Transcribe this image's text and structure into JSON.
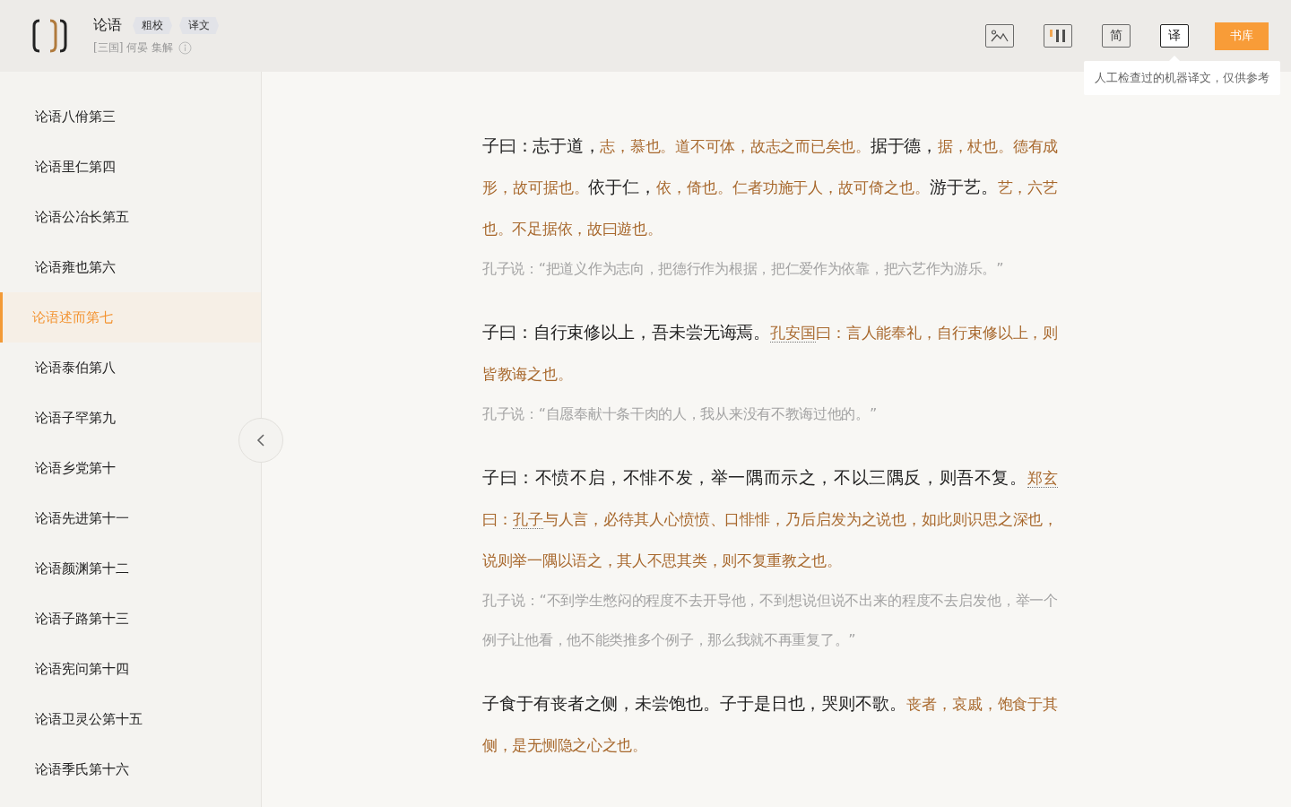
{
  "header": {
    "title": "论语",
    "tags": [
      "粗校",
      "译文"
    ],
    "subtitle": "[三国] 何晏 集解",
    "tools": [
      {
        "kind": "picture",
        "active": false
      },
      {
        "kind": "columns",
        "active": false
      },
      {
        "kind": "text",
        "label": "简",
        "active": false
      },
      {
        "kind": "text",
        "label": "译",
        "active": true
      }
    ],
    "library_button": "书库",
    "tooltip": "人工检查过的机器译文，仅供参考"
  },
  "sidebar": {
    "items": [
      {
        "label": "论语八佾第三",
        "selected": false
      },
      {
        "label": "论语里仁第四",
        "selected": false
      },
      {
        "label": "论语公冶长第五",
        "selected": false
      },
      {
        "label": "论语雍也第六",
        "selected": false
      },
      {
        "label": "论语述而第七",
        "selected": true
      },
      {
        "label": "论语泰伯第八",
        "selected": false
      },
      {
        "label": "论语子罕第九",
        "selected": false
      },
      {
        "label": "论语乡党第十",
        "selected": false
      },
      {
        "label": "论语先进第十一",
        "selected": false
      },
      {
        "label": "论语颜渊第十二",
        "selected": false
      },
      {
        "label": "论语子路第十三",
        "selected": false
      },
      {
        "label": "论语宪问第十四",
        "selected": false
      },
      {
        "label": "论语卫灵公第十五",
        "selected": false
      },
      {
        "label": "论语季氏第十六",
        "selected": false
      }
    ]
  },
  "passages": [
    {
      "segments": [
        {
          "kind": "text",
          "text": "子曰：志于道，"
        },
        {
          "kind": "note",
          "text": "志，慕也。道不可体，故志之而已矣也。"
        },
        {
          "kind": "text",
          "text": "据于德，"
        },
        {
          "kind": "note",
          "text": "据，杖也。德有成形，故可据也。"
        },
        {
          "kind": "text",
          "text": "依于仁，"
        },
        {
          "kind": "note",
          "text": "依，倚也。仁者功施于人，故可倚之也。"
        },
        {
          "kind": "text",
          "text": "游于艺。"
        },
        {
          "kind": "note",
          "text": "艺，六艺也。不足据依，故曰遊也。"
        }
      ],
      "translation": "孔子说：“把道义作为志向，把德行作为根据，把仁爱作为依靠，把六艺作为游乐。”"
    },
    {
      "segments": [
        {
          "kind": "text",
          "text": "子曰：自行束修以上，吾未尝无诲焉。"
        },
        {
          "kind": "person",
          "text": "孔安国"
        },
        {
          "kind": "note",
          "text": "曰：言人能奉礼，自行束修以上，则皆教诲之也。"
        }
      ],
      "translation": "孔子说：“自愿奉献十条干肉的人，我从来没有不教诲过他的。”"
    },
    {
      "segments": [
        {
          "kind": "text",
          "text": "子曰：不愤不启，不悱不发，举一隅而示之，不以三隅反，则吾不复。"
        },
        {
          "kind": "person",
          "text": "郑玄"
        },
        {
          "kind": "note",
          "text": "曰："
        },
        {
          "kind": "person",
          "text": "孔子"
        },
        {
          "kind": "note",
          "text": "与人言，必待其人心愤愤、口悱悱，乃后启发为之说也，如此则识思之深也，说则举一隅以语之，其人不思其类，则不复重教之也。"
        }
      ],
      "translation": "孔子说：“不到学生憋闷的程度不去开导他，不到想说但说不出来的程度不去启发他，举一个例子让他看，他不能类推多个例子，那么我就不再重复了。”"
    },
    {
      "segments": [
        {
          "kind": "text",
          "text": "子食于有丧者之侧，未尝饱也。子于是日也，哭则不歌。"
        },
        {
          "kind": "note",
          "text": "丧者，哀戚，饱食于其侧，是无恻隐之心之也。"
        }
      ]
    }
  ]
}
